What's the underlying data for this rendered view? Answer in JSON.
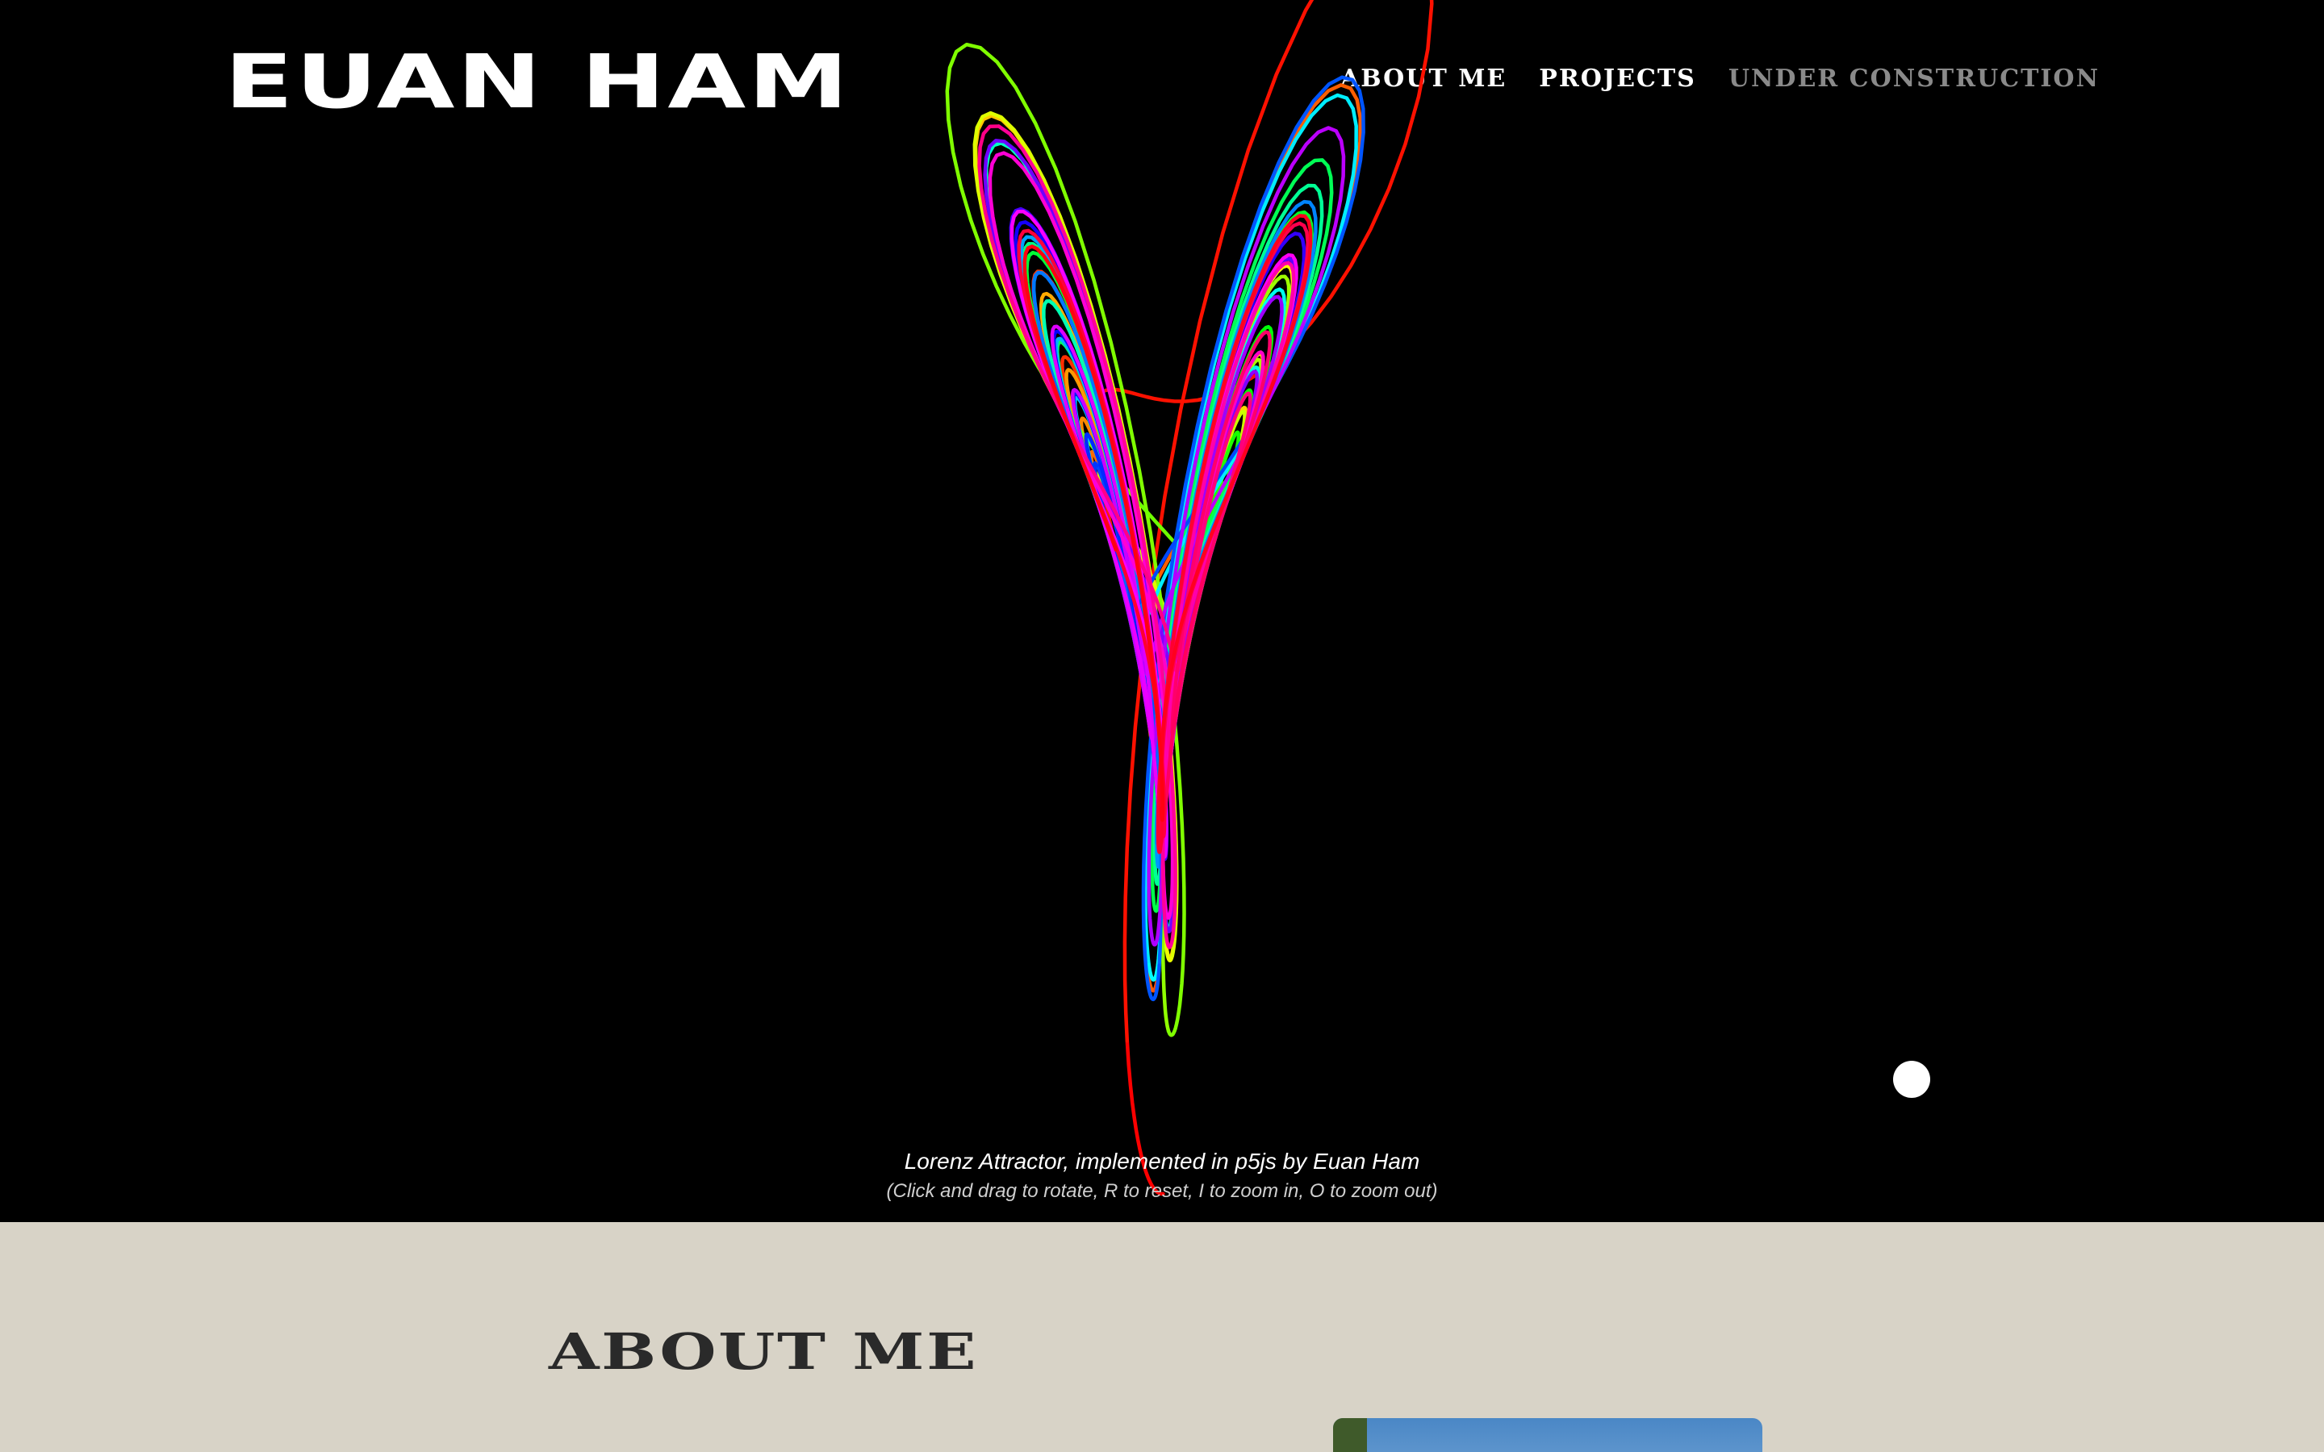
{
  "header": {
    "logo": "EUAN HAM",
    "nav": [
      {
        "label": "ABOUT ME"
      },
      {
        "label": "PROJECTS"
      },
      {
        "label": "UNDER CONSTRUCTION"
      }
    ]
  },
  "hero": {
    "caption": "Lorenz Attractor, implemented in p5js by Euan Ham",
    "instructions": "(Click and drag to rotate, R to reset, I to zoom in, O to zoom out)"
  },
  "about": {
    "title": "ABOUT ME"
  },
  "colors": {
    "hero_background": "#000000",
    "about_background": "#d8d3c7",
    "nav_muted": "#8a8a8a"
  }
}
